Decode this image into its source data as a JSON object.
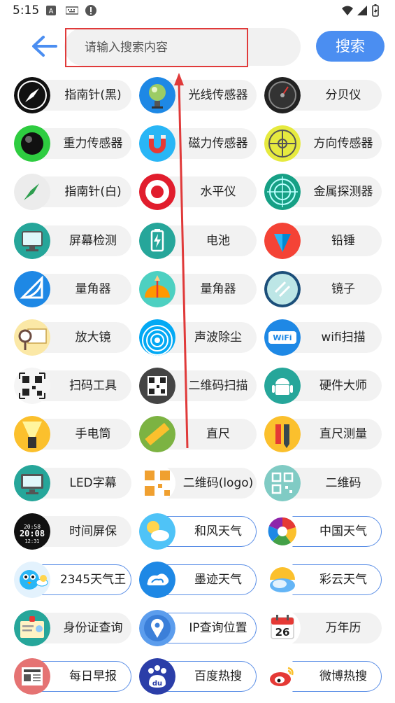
{
  "status_bar": {
    "time": "5:15"
  },
  "search": {
    "placeholder": "请输入搜索内容",
    "button_label": "搜索"
  },
  "items": [
    {
      "label": "指南针(黑)",
      "icon": "compass-black-icon"
    },
    {
      "label": "光线传感器",
      "icon": "light-sensor-icon"
    },
    {
      "label": "分贝仪",
      "icon": "decibel-meter-icon"
    },
    {
      "label": "重力传感器",
      "icon": "gravity-sensor-icon"
    },
    {
      "label": "磁力传感器",
      "icon": "magnet-icon"
    },
    {
      "label": "方向传感器",
      "icon": "direction-sensor-icon"
    },
    {
      "label": "指南针(白)",
      "icon": "compass-white-icon"
    },
    {
      "label": "水平仪",
      "icon": "level-target-icon"
    },
    {
      "label": "金属探测器",
      "icon": "radar-icon"
    },
    {
      "label": "屏幕检测",
      "icon": "monitor-icon"
    },
    {
      "label": "电池",
      "icon": "battery-icon"
    },
    {
      "label": "铅锤",
      "icon": "plumb-bob-icon"
    },
    {
      "label": "量角器",
      "icon": "protractor-blue-icon"
    },
    {
      "label": "量角器",
      "icon": "protractor-orange-icon"
    },
    {
      "label": "镜子",
      "icon": "mirror-icon"
    },
    {
      "label": "放大镜",
      "icon": "magnifier-icon"
    },
    {
      "label": "声波除尘",
      "icon": "sound-wave-icon"
    },
    {
      "label": "wifi扫描",
      "icon": "wifi-icon"
    },
    {
      "label": "扫码工具",
      "icon": "scan-code-icon"
    },
    {
      "label": "二维码扫描",
      "icon": "qr-scan-icon"
    },
    {
      "label": "硬件大师",
      "icon": "android-icon"
    },
    {
      "label": "手电筒",
      "icon": "flashlight-icon"
    },
    {
      "label": "直尺",
      "icon": "ruler-icon"
    },
    {
      "label": "直尺测量",
      "icon": "ruler-pencil-icon"
    },
    {
      "label": "LED字幕",
      "icon": "led-monitor-icon"
    },
    {
      "label": "二维码(logo)",
      "icon": "qr-logo-icon"
    },
    {
      "label": "二维码",
      "icon": "qr-code-icon"
    },
    {
      "label": "时间屏保",
      "icon": "clock-screen-icon"
    },
    {
      "label": "和风天气",
      "icon": "sun-cloud-icon"
    },
    {
      "label": "中国天气",
      "icon": "china-weather-icon"
    },
    {
      "label": "2345天气王",
      "icon": "bird-weather-icon"
    },
    {
      "label": "墨迹天气",
      "icon": "moji-weather-icon"
    },
    {
      "label": "彩云天气",
      "icon": "cloud-umbrella-icon"
    },
    {
      "label": "身份证查询",
      "icon": "id-card-icon"
    },
    {
      "label": "IP查询位置",
      "icon": "location-pin-icon"
    },
    {
      "label": "万年历",
      "icon": "calendar-icon"
    },
    {
      "label": "每日早报",
      "icon": "newspaper-icon"
    },
    {
      "label": "百度热搜",
      "icon": "baidu-icon"
    },
    {
      "label": "微博热搜",
      "icon": "weibo-icon"
    }
  ],
  "calendar_day": "26"
}
